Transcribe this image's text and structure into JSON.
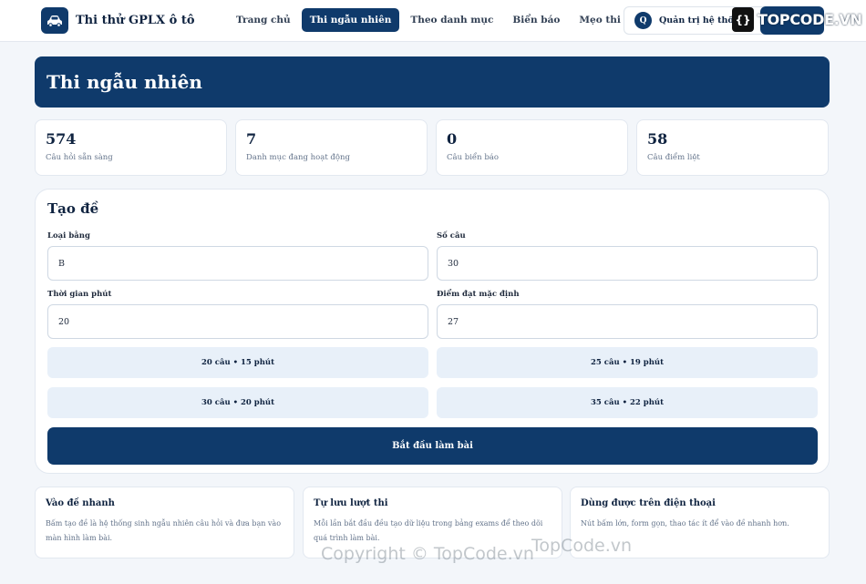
{
  "colors": {
    "primary": "#0f3a6b",
    "background": "#f3f6fa",
    "preset_bg": "#e8f0f9",
    "muted_text": "#64748b"
  },
  "brand": {
    "icon": "car-icon",
    "title": "Thi thử GPLX ô tô"
  },
  "nav": {
    "items": [
      {
        "label": "Trang chủ",
        "active": false
      },
      {
        "label": "Thi ngẫu nhiên",
        "active": true
      },
      {
        "label": "Theo danh mục",
        "active": false
      },
      {
        "label": "Biển báo",
        "active": false
      },
      {
        "label": "Mẹo thi",
        "active": false
      }
    ]
  },
  "admin": {
    "avatar_letter": "Q",
    "label": "Quản trị hệ thống"
  },
  "hero": {
    "title": "Thi ngẫu nhiên"
  },
  "stats": [
    {
      "value": "574",
      "label": "Câu hỏi sẵn sàng"
    },
    {
      "value": "7",
      "label": "Danh mục đang hoạt động"
    },
    {
      "value": "0",
      "label": "Câu biển báo"
    },
    {
      "value": "58",
      "label": "Câu điểm liệt"
    }
  ],
  "form": {
    "title": "Tạo đề",
    "license_type": {
      "label": "Loại bằng",
      "value": "B"
    },
    "question_count": {
      "label": "Số câu",
      "value": "30"
    },
    "duration": {
      "label": "Thời gian phút",
      "value": "20"
    },
    "pass_score": {
      "label": "Điểm đạt mặc định",
      "value": "27"
    },
    "presets": [
      "20 câu • 15 phút",
      "25 câu • 19 phút",
      "30 câu • 20 phút",
      "35 câu • 22 phút"
    ],
    "start_label": "Bắt đầu làm bài"
  },
  "info_cards": [
    {
      "title": "Vào đề nhanh",
      "text": "Bấm tạo đề là hệ thống sinh ngẫu nhiên câu hỏi và đưa bạn vào màn hình làm bài."
    },
    {
      "title": "Tự lưu lượt thi",
      "text": "Mỗi lần bắt đầu đều tạo dữ liệu trong bảng exams để theo dõi quá trình làm bài."
    },
    {
      "title": "Dùng được trên điện thoại",
      "text": "Nút bấm lớn, form gọn, thao tác ít để vào đề nhanh hơn."
    }
  ],
  "watermark": {
    "logo_text": "TOPCODE.VN",
    "center_text": "TopCode.vn",
    "copyright_text": "Copyright © TopCode.vn"
  }
}
